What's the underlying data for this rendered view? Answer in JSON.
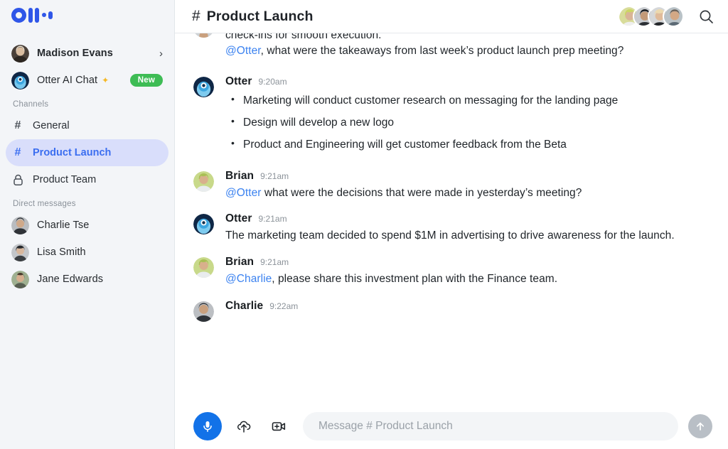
{
  "brand": {
    "logo_name": "otter-logo",
    "logo_color": "#2f56e8",
    "accent_blue": "#3b6ef0",
    "mention_blue": "#3b82f0",
    "badge_green": "#3ebc55",
    "mic_blue": "#1272e8"
  },
  "sidebar": {
    "user": {
      "name": "Madison Evans",
      "chevron": "›"
    },
    "ai_chat": {
      "label": "Otter AI Chat",
      "sparkle": "✦",
      "badge": "New"
    },
    "channels_title": "Channels",
    "channels": [
      {
        "label": "General",
        "icon": "hash",
        "active": false
      },
      {
        "label": "Product Launch",
        "icon": "hash",
        "active": true
      },
      {
        "label": "Product Team",
        "icon": "lock",
        "active": false
      }
    ],
    "dm_title": "Direct messages",
    "dms": [
      {
        "label": "Charlie Tse"
      },
      {
        "label": "Lisa Smith"
      },
      {
        "label": "Jane Edwards"
      }
    ]
  },
  "header": {
    "hash": "#",
    "title": "Product Launch",
    "search_icon": "search-icon",
    "member_count": 4
  },
  "messages": [
    {
      "id": "partial",
      "partial": true,
      "line1": "check-ins for smooth execution.",
      "mention": "@Otter",
      "rest": ", what were the takeaways from last week’s product launch prep meeting?"
    },
    {
      "id": "otter-1",
      "name": "Otter",
      "time": "9:20am",
      "avatar": "otter",
      "bullets": [
        "Marketing will conduct customer research on messaging for the landing page",
        "Design will develop a new logo",
        "Product and Engineering will get customer feedback from the Beta"
      ]
    },
    {
      "id": "brian-1",
      "name": "Brian",
      "time": "9:21am",
      "avatar": "brian",
      "mention": "@Otter",
      "text": " what were the decisions that were made in yesterday’s meeting?"
    },
    {
      "id": "otter-2",
      "name": "Otter",
      "time": "9:21am",
      "avatar": "otter",
      "text": "The marketing team decided to spend $1M in advertising to drive awareness for the launch."
    },
    {
      "id": "brian-2",
      "name": "Brian",
      "time": "9:21am",
      "avatar": "brian",
      "mention": "@Charlie",
      "text": ", please share this investment plan with the Finance team."
    },
    {
      "id": "charlie-1",
      "name": "Charlie",
      "time": "9:22am",
      "avatar": "charlie",
      "text": ""
    }
  ],
  "composer": {
    "mic_icon": "microphone-icon",
    "upload_icon": "cloud-upload-icon",
    "video_icon": "video-add-icon",
    "placeholder": "Message # Product Launch",
    "value": "",
    "send_icon": "arrow-up-icon"
  }
}
